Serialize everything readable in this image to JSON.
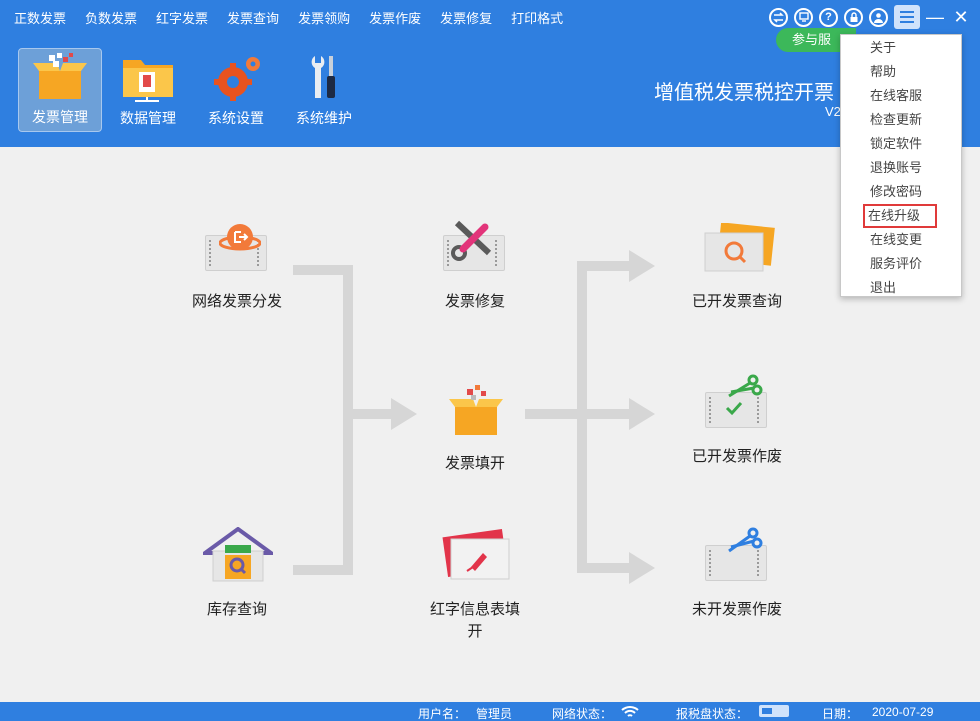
{
  "menubar": {
    "items": [
      "正数发票",
      "负数发票",
      "红字发票",
      "发票查询",
      "发票领购",
      "发票作废",
      "发票修复",
      "打印格式"
    ]
  },
  "window_tools": {
    "icons": [
      "exchange-icon",
      "screen-icon",
      "help-icon",
      "lock-icon",
      "user-icon",
      "hamburger-menu-icon"
    ],
    "help_glyph": "?"
  },
  "service_pill": "参与服",
  "toolbar": {
    "items": [
      {
        "label": "发票管理",
        "icon": "invoice-box-icon",
        "active": true
      },
      {
        "label": "数据管理",
        "icon": "folder-icon",
        "active": false
      },
      {
        "label": "系统设置",
        "icon": "gear-icon",
        "active": false
      },
      {
        "label": "系统维护",
        "icon": "tools-icon",
        "active": false
      }
    ]
  },
  "app": {
    "title": "增值税发票税控开票",
    "version": "V2"
  },
  "flow_nodes": {
    "network_dispatch": "网络发票分发",
    "invoice_repair": "发票修复",
    "issued_query": "已开发票查询",
    "invoice_fill": "发票填开",
    "issued_void": "已开发票作废",
    "inventory_query": "库存查询",
    "red_info_fill": "红字信息表填开",
    "unissued_void": "未开发票作废"
  },
  "statusbar": {
    "user_label": "用户名：",
    "user_value": "管理员",
    "network_label": "网络状态：",
    "disk_label": "报税盘状态：",
    "date_label": "日期：",
    "date_value": "2020-07-29"
  },
  "dropdown": {
    "items": [
      "关于",
      "帮助",
      "在线客服",
      "检查更新",
      "锁定软件",
      "退换账号",
      "修改密码",
      "在线升级",
      "在线变更",
      "服务评价",
      "退出"
    ],
    "highlighted": "在线升级"
  },
  "colors": {
    "brand_blue": "#2f7fe0",
    "flow_gray": "#d6d6d6",
    "highlight_red": "#e03a3a",
    "service_green": "#3cb85a"
  }
}
